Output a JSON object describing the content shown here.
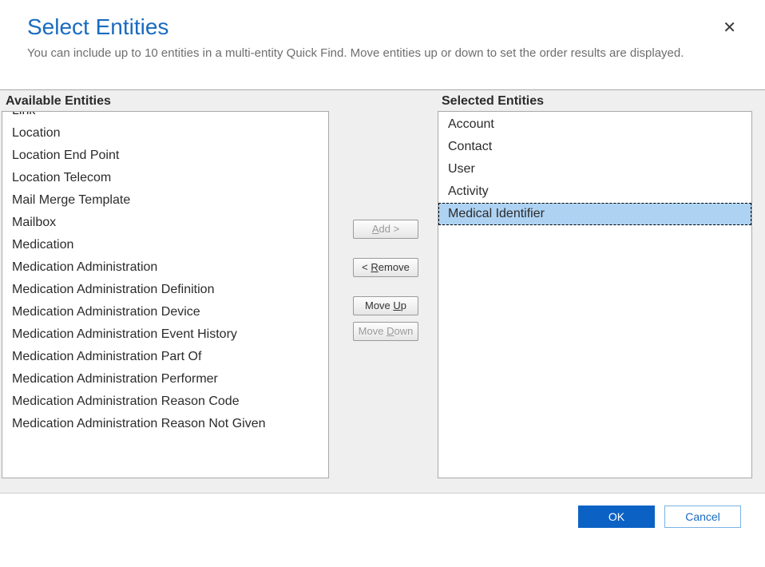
{
  "header": {
    "title": "Select Entities",
    "subtitle": "You can include up to 10 entities in a multi-entity Quick Find. Move entities up or down to set the order results are displayed."
  },
  "labels": {
    "available": "Available Entities",
    "selected": "Selected Entities"
  },
  "available_entities": [
    "Link",
    "Location",
    "Location End Point",
    "Location Telecom",
    "Mail Merge Template",
    "Mailbox",
    "Medication",
    "Medication Administration",
    "Medication Administration Definition",
    "Medication Administration Device",
    "Medication Administration Event History",
    "Medication Administration Part Of",
    "Medication Administration Performer",
    "Medication Administration Reason Code",
    "Medication Administration Reason Not Given"
  ],
  "selected_entities": [
    {
      "label": "Account",
      "selected": false
    },
    {
      "label": "Contact",
      "selected": false
    },
    {
      "label": "User",
      "selected": false
    },
    {
      "label": "Activity",
      "selected": false
    },
    {
      "label": "Medical Identifier",
      "selected": true
    }
  ],
  "buttons": {
    "add": {
      "label": "Add >",
      "accel_index": 0,
      "enabled": false
    },
    "remove": {
      "label": "< Remove",
      "accel_index": 2,
      "enabled": true
    },
    "moveup": {
      "label": "Move Up",
      "accel_index": 5,
      "enabled": true
    },
    "movedown": {
      "label": "Move Down",
      "accel_index": 5,
      "enabled": false
    }
  },
  "footer": {
    "ok": "OK",
    "cancel": "Cancel"
  }
}
